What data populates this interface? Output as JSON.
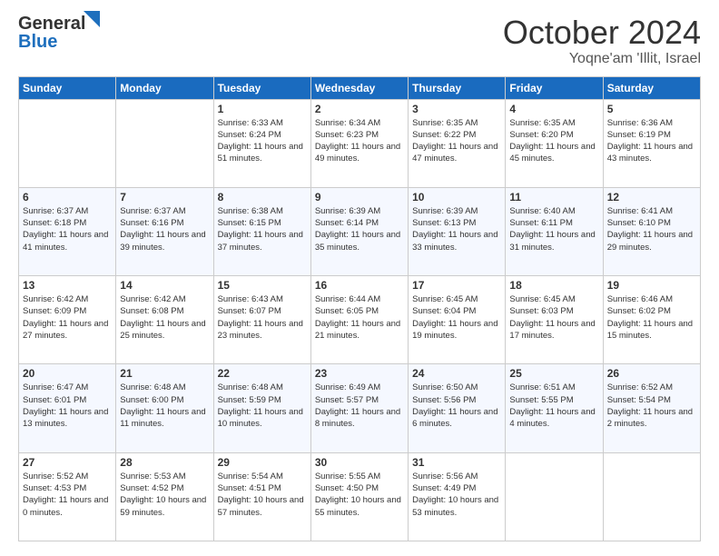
{
  "header": {
    "logo_general": "General",
    "logo_blue": "Blue",
    "month_title": "October 2024",
    "subtitle": "Yoqne'am 'Illit, Israel"
  },
  "days_of_week": [
    "Sunday",
    "Monday",
    "Tuesday",
    "Wednesday",
    "Thursday",
    "Friday",
    "Saturday"
  ],
  "weeks": [
    [
      {
        "day": "",
        "info": ""
      },
      {
        "day": "",
        "info": ""
      },
      {
        "day": "1",
        "info": "Sunrise: 6:33 AM\nSunset: 6:24 PM\nDaylight: 11 hours and 51 minutes."
      },
      {
        "day": "2",
        "info": "Sunrise: 6:34 AM\nSunset: 6:23 PM\nDaylight: 11 hours and 49 minutes."
      },
      {
        "day": "3",
        "info": "Sunrise: 6:35 AM\nSunset: 6:22 PM\nDaylight: 11 hours and 47 minutes."
      },
      {
        "day": "4",
        "info": "Sunrise: 6:35 AM\nSunset: 6:20 PM\nDaylight: 11 hours and 45 minutes."
      },
      {
        "day": "5",
        "info": "Sunrise: 6:36 AM\nSunset: 6:19 PM\nDaylight: 11 hours and 43 minutes."
      }
    ],
    [
      {
        "day": "6",
        "info": "Sunrise: 6:37 AM\nSunset: 6:18 PM\nDaylight: 11 hours and 41 minutes."
      },
      {
        "day": "7",
        "info": "Sunrise: 6:37 AM\nSunset: 6:16 PM\nDaylight: 11 hours and 39 minutes."
      },
      {
        "day": "8",
        "info": "Sunrise: 6:38 AM\nSunset: 6:15 PM\nDaylight: 11 hours and 37 minutes."
      },
      {
        "day": "9",
        "info": "Sunrise: 6:39 AM\nSunset: 6:14 PM\nDaylight: 11 hours and 35 minutes."
      },
      {
        "day": "10",
        "info": "Sunrise: 6:39 AM\nSunset: 6:13 PM\nDaylight: 11 hours and 33 minutes."
      },
      {
        "day": "11",
        "info": "Sunrise: 6:40 AM\nSunset: 6:11 PM\nDaylight: 11 hours and 31 minutes."
      },
      {
        "day": "12",
        "info": "Sunrise: 6:41 AM\nSunset: 6:10 PM\nDaylight: 11 hours and 29 minutes."
      }
    ],
    [
      {
        "day": "13",
        "info": "Sunrise: 6:42 AM\nSunset: 6:09 PM\nDaylight: 11 hours and 27 minutes."
      },
      {
        "day": "14",
        "info": "Sunrise: 6:42 AM\nSunset: 6:08 PM\nDaylight: 11 hours and 25 minutes."
      },
      {
        "day": "15",
        "info": "Sunrise: 6:43 AM\nSunset: 6:07 PM\nDaylight: 11 hours and 23 minutes."
      },
      {
        "day": "16",
        "info": "Sunrise: 6:44 AM\nSunset: 6:05 PM\nDaylight: 11 hours and 21 minutes."
      },
      {
        "day": "17",
        "info": "Sunrise: 6:45 AM\nSunset: 6:04 PM\nDaylight: 11 hours and 19 minutes."
      },
      {
        "day": "18",
        "info": "Sunrise: 6:45 AM\nSunset: 6:03 PM\nDaylight: 11 hours and 17 minutes."
      },
      {
        "day": "19",
        "info": "Sunrise: 6:46 AM\nSunset: 6:02 PM\nDaylight: 11 hours and 15 minutes."
      }
    ],
    [
      {
        "day": "20",
        "info": "Sunrise: 6:47 AM\nSunset: 6:01 PM\nDaylight: 11 hours and 13 minutes."
      },
      {
        "day": "21",
        "info": "Sunrise: 6:48 AM\nSunset: 6:00 PM\nDaylight: 11 hours and 11 minutes."
      },
      {
        "day": "22",
        "info": "Sunrise: 6:48 AM\nSunset: 5:59 PM\nDaylight: 11 hours and 10 minutes."
      },
      {
        "day": "23",
        "info": "Sunrise: 6:49 AM\nSunset: 5:57 PM\nDaylight: 11 hours and 8 minutes."
      },
      {
        "day": "24",
        "info": "Sunrise: 6:50 AM\nSunset: 5:56 PM\nDaylight: 11 hours and 6 minutes."
      },
      {
        "day": "25",
        "info": "Sunrise: 6:51 AM\nSunset: 5:55 PM\nDaylight: 11 hours and 4 minutes."
      },
      {
        "day": "26",
        "info": "Sunrise: 6:52 AM\nSunset: 5:54 PM\nDaylight: 11 hours and 2 minutes."
      }
    ],
    [
      {
        "day": "27",
        "info": "Sunrise: 5:52 AM\nSunset: 4:53 PM\nDaylight: 11 hours and 0 minutes."
      },
      {
        "day": "28",
        "info": "Sunrise: 5:53 AM\nSunset: 4:52 PM\nDaylight: 10 hours and 59 minutes."
      },
      {
        "day": "29",
        "info": "Sunrise: 5:54 AM\nSunset: 4:51 PM\nDaylight: 10 hours and 57 minutes."
      },
      {
        "day": "30",
        "info": "Sunrise: 5:55 AM\nSunset: 4:50 PM\nDaylight: 10 hours and 55 minutes."
      },
      {
        "day": "31",
        "info": "Sunrise: 5:56 AM\nSunset: 4:49 PM\nDaylight: 10 hours and 53 minutes."
      },
      {
        "day": "",
        "info": ""
      },
      {
        "day": "",
        "info": ""
      }
    ]
  ]
}
